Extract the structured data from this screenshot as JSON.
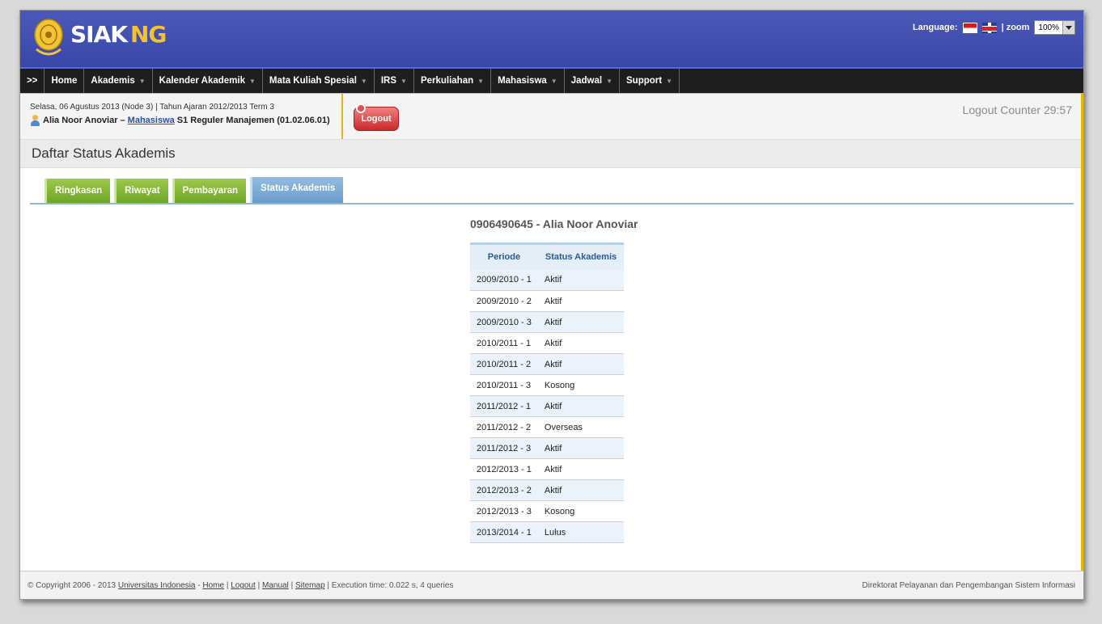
{
  "brand": {
    "part1": "SIAK",
    "part2": "NG"
  },
  "header": {
    "language_label": "Language:",
    "zoom_label": "| zoom",
    "zoom_value": "100%"
  },
  "nav": {
    "items": [
      {
        "label": ">>"
      },
      {
        "label": "Home"
      },
      {
        "label": "Akademis"
      },
      {
        "label": "Kalender Akademik"
      },
      {
        "label": "Mata Kuliah Spesial"
      },
      {
        "label": "IRS"
      },
      {
        "label": "Perkuliahan"
      },
      {
        "label": "Mahasiswa"
      },
      {
        "label": "Jadwal"
      },
      {
        "label": "Support"
      }
    ]
  },
  "info": {
    "datetime": "Selasa, 06 Agustus 2013 (Node 3) | Tahun Ajaran 2012/2013 Term 3",
    "user_name": "Alia Noor Anoviar –",
    "role_link": "Mahasiswa",
    "program": "S1 Reguler Manajemen (01.02.06.01)",
    "logout_label": "Logout",
    "counter": "Logout Counter 29:57"
  },
  "page_title": "Daftar Status Akademis",
  "tabs": [
    {
      "label": "Ringkasan"
    },
    {
      "label": "Riwayat"
    },
    {
      "label": "Pembayaran"
    },
    {
      "label": "Status Akademis"
    }
  ],
  "student_heading": "0906490645 - Alia Noor Anoviar",
  "table": {
    "headers": [
      "Periode",
      "Status Akademis"
    ],
    "rows": [
      [
        "2009/2010 - 1",
        "Aktif"
      ],
      [
        "2009/2010 - 2",
        "Aktif"
      ],
      [
        "2009/2010 - 3",
        "Aktif"
      ],
      [
        "2010/2011 - 1",
        "Aktif"
      ],
      [
        "2010/2011 - 2",
        "Aktif"
      ],
      [
        "2010/2011 - 3",
        "Kosong"
      ],
      [
        "2011/2012 - 1",
        "Aktif"
      ],
      [
        "2011/2012 - 2",
        "Overseas"
      ],
      [
        "2011/2012 - 3",
        "Aktif"
      ],
      [
        "2012/2013 - 1",
        "Aktif"
      ],
      [
        "2012/2013 - 2",
        "Aktif"
      ],
      [
        "2012/2013 - 3",
        "Kosong"
      ],
      [
        "2013/2014 - 1",
        "Lulus"
      ]
    ]
  },
  "footer": {
    "copyright": "© Copyright 2006 - 2013",
    "links": [
      "Universitas Indonesia",
      "Home",
      "Logout",
      "Manual",
      "Sitemap"
    ],
    "exec": "| Execution time: 0.022 s, 4 queries",
    "right": "Direktorat Pelayanan dan Pengembangan Sistem Informasi"
  }
}
